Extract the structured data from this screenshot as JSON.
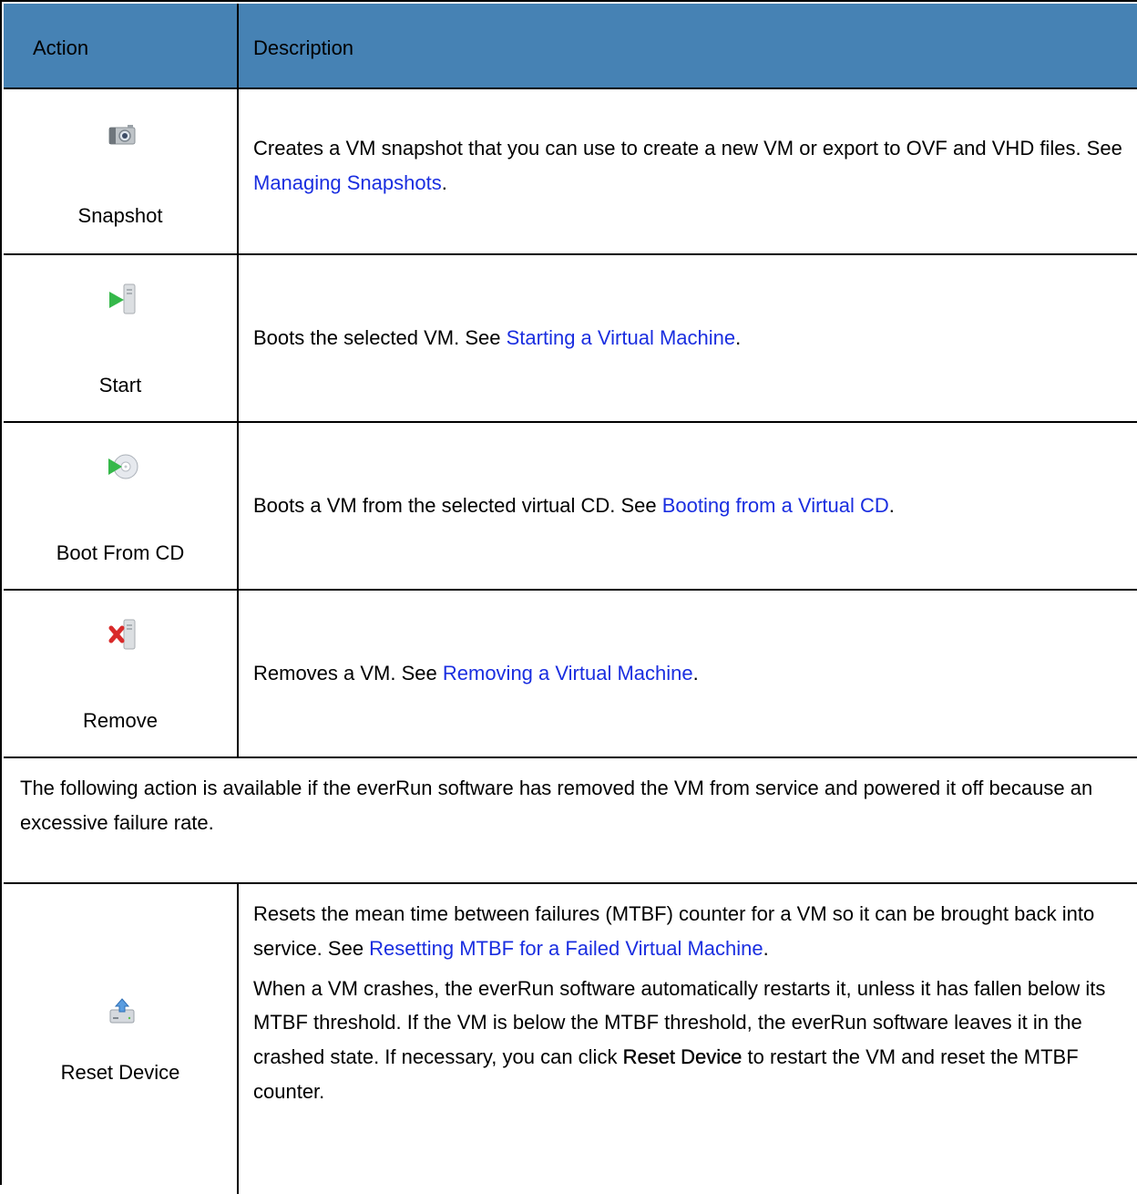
{
  "header": {
    "action": "Action",
    "description": "Description"
  },
  "rows": [
    {
      "label": "Snapshot",
      "icon": "camera-icon",
      "text_before": "Creates a VM snapshot that you can use to create a new VM or export to OVF and VHD files. See ",
      "link": "Managing Snapshots",
      "text_after": "."
    },
    {
      "label": "Start",
      "icon": "play-server-icon",
      "text_before": "Boots the selected VM. See ",
      "link": "Starting a Virtual Machine",
      "text_after": "."
    },
    {
      "label": "Boot From CD",
      "icon": "boot-cd-icon",
      "text_before": "Boots a VM from the selected virtual CD. See ",
      "link": "Booting from a Virtual CD",
      "text_after": "."
    },
    {
      "label": "Remove",
      "icon": "remove-server-icon",
      "text_before": "Removes a VM. See ",
      "link": "Removing a Virtual Machine",
      "text_after": "."
    }
  ],
  "note": "The following action is available if the everRun software has removed the VM from service and powered it off because an excessive failure rate.",
  "reset": {
    "label": "Reset Device",
    "icon": "reset-device-icon",
    "p1_before": "Resets the mean time between failures (MTBF) counter for a VM so it can be brought back into service. See ",
    "p1_link": "Resetting MTBF for a Failed Virtual Machine",
    "p1_after": ".",
    "p2_before": "When a VM crashes, the everRun software automatically restarts it, unless it has fallen below its MTBF threshold. If the VM is below the MTBF threshold, the everRun software leaves it in the crashed state. If necessary, you can click ",
    "p2_bold": "Reset Device",
    "p2_after": " to restart the VM and reset the MTBF counter."
  }
}
